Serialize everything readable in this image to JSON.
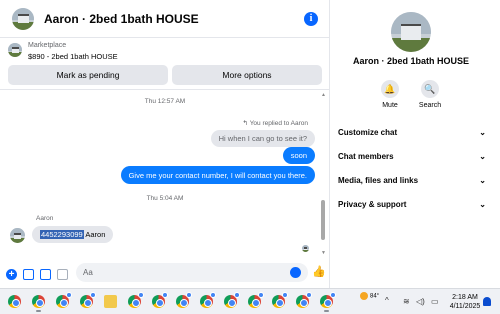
{
  "header": {
    "title": "Aaron · 2bed 1bath HOUSE",
    "info_icon": "info-icon",
    "accent": "#0866ff"
  },
  "marketplace": {
    "label": "Marketplace",
    "price_title": "$890 - 2bed 1bath HOUSE",
    "mark_pending": "Mark as pending",
    "more_options": "More options"
  },
  "messages": {
    "time1": "Thu 12:57 AM",
    "replied": "You replied to Aaron",
    "quoted": "Hi when I can go to see it?",
    "sent1": "soon",
    "sent2": "Give me your contact number, I will contact you there.",
    "time2": "Thu 5:04 AM",
    "sender": "Aaron",
    "recv_selected": "4452293099",
    "recv_rest": " Aaron"
  },
  "composer": {
    "placeholder": "Aa"
  },
  "side_panel": {
    "name": "Aaron · 2bed 1bath HOUSE",
    "mute": "Mute",
    "search": "Search",
    "rows": [
      {
        "label": "Customize chat"
      },
      {
        "label": "Chat members"
      },
      {
        "label": "Media, files and links"
      },
      {
        "label": "Privacy & support"
      }
    ]
  },
  "taskbar": {
    "temperature": "84°",
    "time": "2:18 AM",
    "date": "4/11/2025"
  }
}
